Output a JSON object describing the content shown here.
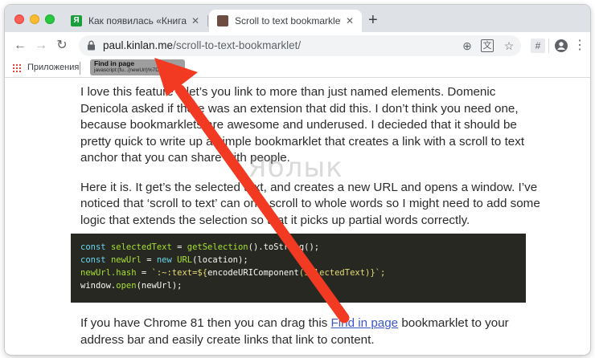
{
  "tabs": [
    {
      "label": "Как появилась «Книга рекорд",
      "favicon": "Я",
      "active": false
    },
    {
      "label": "Scroll to text bookmarklet - Mo",
      "favicon": "",
      "active": true
    }
  ],
  "toolbar": {
    "url_host": "paul.kinlan.me",
    "url_path": "/scroll-to-text-bookmarklet/"
  },
  "bookmarks": {
    "apps_label": "Приложения",
    "tooltip_title": "Find in page",
    "tooltip_sub": "javascript:(fu...(newUrl)%7D)()"
  },
  "article": {
    "p1": "I love this feature it let’s you link to more than just named elements. Domenic Denicola asked if there was an extension that did this. I don’t think you need one, because bookmarklets are awesome and underused. I decieded that it should be pretty quick to write up a simple bookmarklet that creates a link with a scroll to text anchor that you can share with people.",
    "p2": "Here it is. It get’s the selected text, and creates a new URL and opens a window. I’ve noticed that ‘scroll to text’ can only scroll to whole words so I might need to add some logic that extends the selection so that it picks up partial words correctly.",
    "code": {
      "l1_kw": "const",
      "l1_var": "selectedText",
      "l1_eq": " = ",
      "l1_fn": "getSelection",
      "l1_rest": "().toString();",
      "l2_kw": "const",
      "l2_var": "newUrl",
      "l2_eq": " = ",
      "l2_new": "new",
      "l2_fn": "URL",
      "l2_rest": "(location);",
      "l3_var": "newUrl.hash",
      "l3_eq": " = ",
      "l3_str": "`:~:text=${",
      "l3_fn": "encodeURIComponent",
      "l3_rest": "(selectedText)}`;",
      "l4_plain": "window.",
      "l4_fn": "open",
      "l4_rest": "(newUrl);"
    },
    "p3_before": "If you have Chrome 81 then you can drag this ",
    "p3_link": "Find in page",
    "p3_after": " bookmarklet to your address bar and easily create links that link to content."
  },
  "watermark": "Яблык",
  "colors": {
    "arrow": "#f23a22",
    "link": "#3b57c4",
    "code_bg": "#272822"
  }
}
